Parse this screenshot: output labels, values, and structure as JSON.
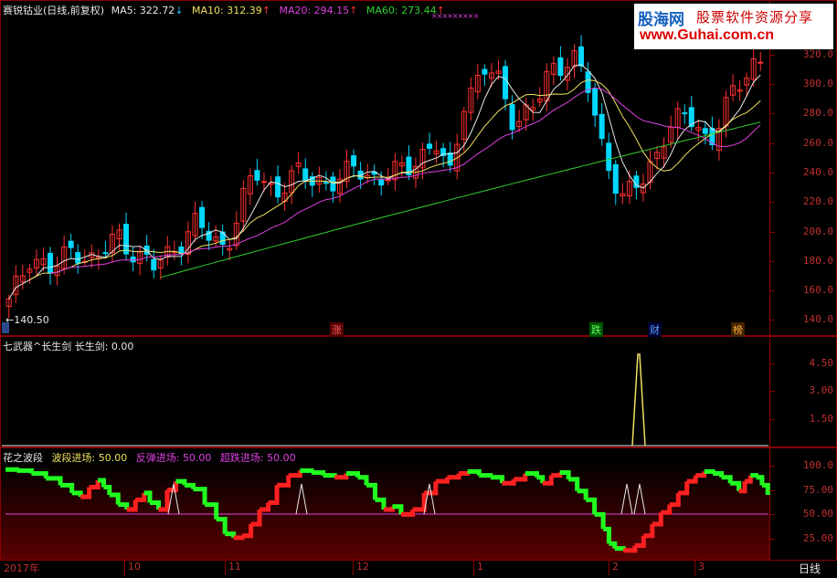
{
  "main": {
    "stock_name": "赛锐钴业",
    "period": "(日线,前复权)",
    "ma": [
      {
        "label": "MA5: 322.72",
        "arrow": "↓",
        "color": "#e8e8e8",
        "arrow_color": "#30c0ff"
      },
      {
        "label": "MA10: 312.39",
        "arrow": "↑",
        "color": "#f0e060",
        "arrow_color": "#ff3030"
      },
      {
        "label": "MA20: 294.15",
        "arrow": "↑",
        "color": "#e040e0",
        "arrow_color": "#ff3030"
      },
      {
        "label": "MA60: 273.44",
        "arrow": "↑",
        "color": "#30d030",
        "arrow_color": "#ff3030"
      }
    ],
    "low_marker": "←140.50",
    "y_ticks": [
      "320.0",
      "300.0",
      "280.0",
      "260.0",
      "240.0",
      "220.0",
      "200.0",
      "180.0",
      "160.0",
      "140.0"
    ],
    "bottom_marks": [
      {
        "text": "涨",
        "color": "#ff6060",
        "bg": "#500"
      },
      {
        "text": "跌",
        "color": "#60ff60",
        "bg": "#050"
      },
      {
        "text": "财",
        "color": "#60a0ff",
        "bg": "#003"
      },
      {
        "text": "榜",
        "color": "#ffb040",
        "bg": "#420"
      }
    ],
    "xx_marks": "×××××××××"
  },
  "ind1": {
    "title": "七武器^长生剑",
    "value_label": "长生剑: 0.00",
    "y_ticks": [
      "4.50",
      "3.00",
      "1.50"
    ]
  },
  "ind2": {
    "title": "花之波段",
    "legend": [
      {
        "text": "波段进场: 50.00",
        "color": "#f0e060"
      },
      {
        "text": "反弹进场: 50.00",
        "color": "#e040e0"
      },
      {
        "text": "超跌进场: 50.00",
        "color": "#e040e0"
      }
    ],
    "y_ticks": [
      "100.0",
      "75.00",
      "50.00",
      "25.00"
    ]
  },
  "x_axis": {
    "labels": [
      "2017年",
      "10",
      "11",
      "12",
      "1",
      "2",
      "3"
    ],
    "period_button": "日线"
  },
  "watermark": {
    "line1_cn": "股海网",
    "line1_rest": "股票软件资源分享",
    "line2": "www.Guhai.com.cn"
  },
  "colors": {
    "up": "#ff3030",
    "down": "#00d8ff",
    "bg": "#000000",
    "frame": "#8b0000"
  },
  "chart_data": {
    "type": "candlestick",
    "y_range": [
      135,
      325
    ],
    "ma_values_last": {
      "MA5": 322.72,
      "MA10": 312.39,
      "MA20": 294.15,
      "MA60": 273.44
    },
    "low_point": 140.5
  }
}
